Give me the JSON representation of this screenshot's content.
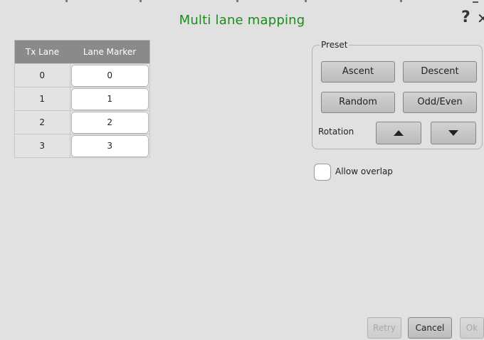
{
  "dialog": {
    "title": "Multi lane mapping",
    "help": "?",
    "close": "✕"
  },
  "table": {
    "headers": [
      "Tx Lane",
      "Lane Marker"
    ],
    "rows": [
      {
        "tx_lane": "0",
        "lane_marker": "0"
      },
      {
        "tx_lane": "1",
        "lane_marker": "1"
      },
      {
        "tx_lane": "2",
        "lane_marker": "2"
      },
      {
        "tx_lane": "3",
        "lane_marker": "3"
      }
    ]
  },
  "preset": {
    "legend": "Preset",
    "buttons": {
      "ascent": "Ascent",
      "descent": "Descent",
      "random": "Random",
      "odd_even": "Odd/Even"
    },
    "rotation_label": "Rotation",
    "rotation_icons": [
      "triangle-up-icon",
      "triangle-down-icon"
    ]
  },
  "allow_overlap": {
    "label": "Allow overlap",
    "checked": false
  },
  "footer": {
    "retry": "Retry",
    "cancel": "Cancel",
    "ok": "Ok"
  },
  "colors": {
    "title": "#1c8a1c",
    "header_bg": "#8a8a8a",
    "background": "#e1e1e1"
  }
}
